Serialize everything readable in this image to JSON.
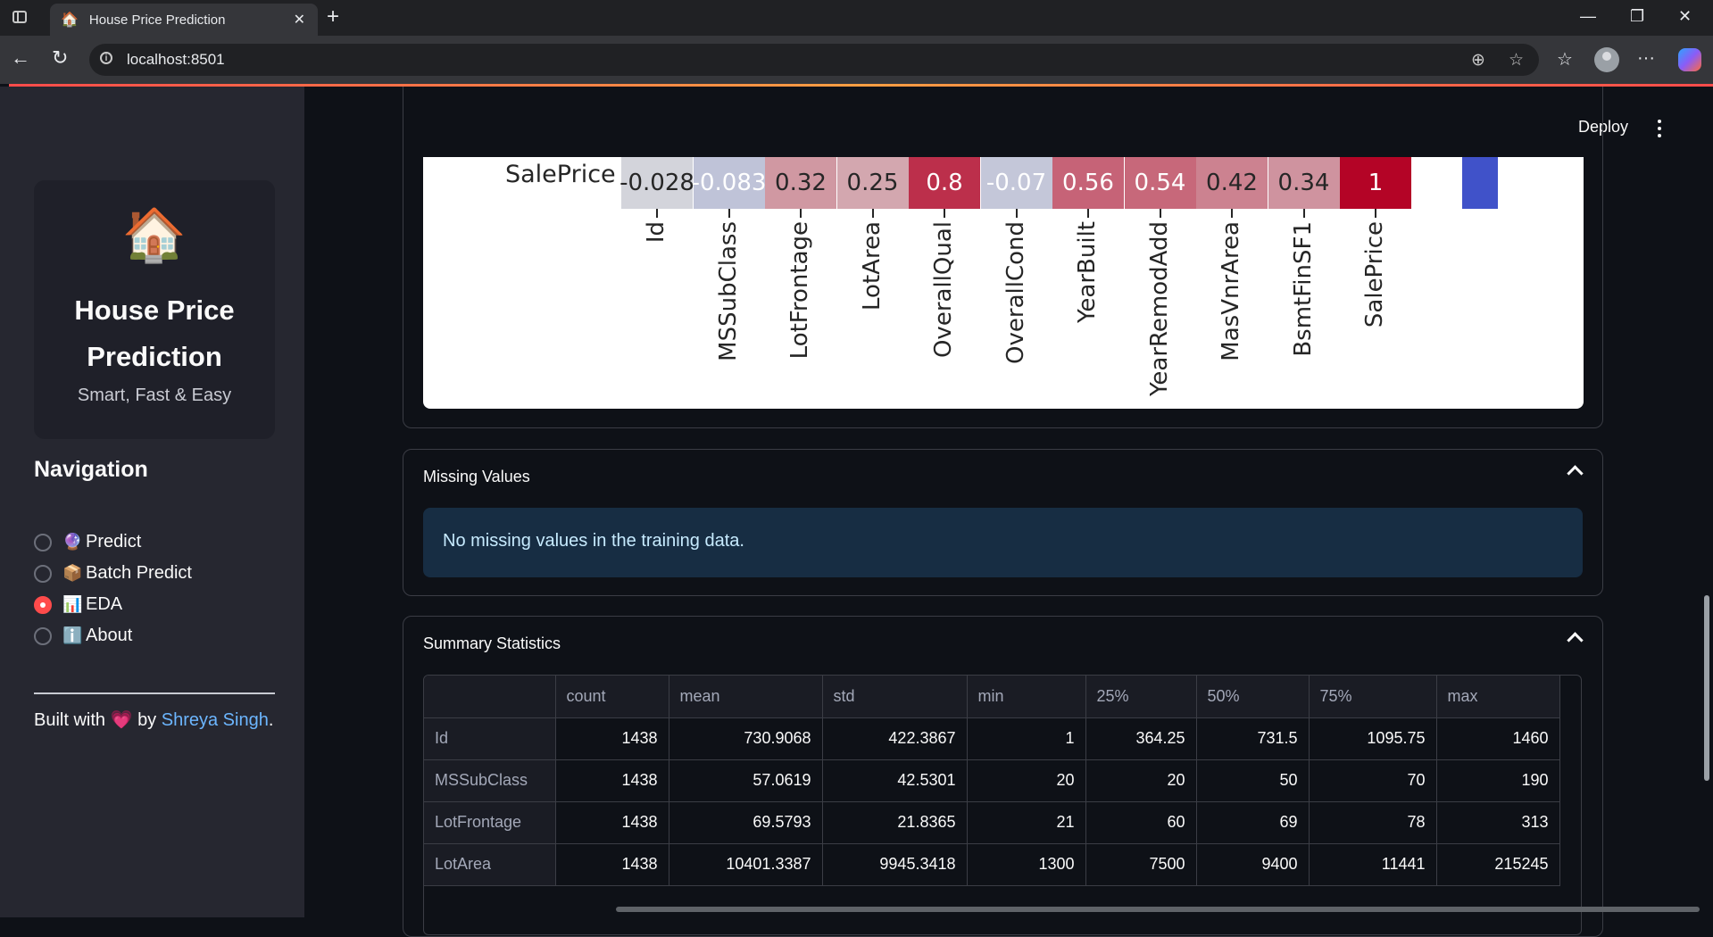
{
  "browser": {
    "tab_title": "House Price Prediction",
    "tab_favicon": "🏠",
    "url": "localhost:8501"
  },
  "sidebar": {
    "logo": "🏠",
    "title_line1": "House Price",
    "title_line2": "Prediction",
    "subtitle": "Smart, Fast & Easy",
    "nav_heading": "Navigation",
    "items": [
      {
        "emoji": "🔮",
        "label": "Predict",
        "selected": false
      },
      {
        "emoji": "📦",
        "label": "Batch Predict",
        "selected": false
      },
      {
        "emoji": "📊",
        "label": "EDA",
        "selected": true
      },
      {
        "emoji": "ℹ️",
        "label": "About",
        "selected": false
      }
    ],
    "built_prefix": "Built with",
    "built_heart": "💗",
    "built_by": "by",
    "author": "Shreya Singh",
    "built_suffix": "."
  },
  "header": {
    "deploy_label": "Deploy"
  },
  "chart_data": {
    "type": "heatmap",
    "row_label": "SalePrice",
    "columns": [
      "Id",
      "MSSubClass",
      "LotFrontage",
      "LotArea",
      "OverallQual",
      "OverallCond",
      "YearBuilt",
      "YearRemodAdd",
      "MasVnrArea",
      "BsmtFinSF1",
      "SalePrice"
    ],
    "values": [
      -0.028,
      -0.083,
      0.32,
      0.25,
      0.8,
      -0.07,
      0.56,
      0.54,
      0.42,
      0.34,
      1
    ],
    "labels": [
      "-0.028",
      "-0.083",
      "0.32",
      "0.25",
      "0.8",
      "-0.07",
      "0.56",
      "0.54",
      "0.42",
      "0.34",
      "1"
    ],
    "colormap": "coolwarm"
  },
  "missing_values": {
    "title": "Missing Values",
    "message": "No missing values in the training data."
  },
  "summary": {
    "title": "Summary Statistics",
    "columns": [
      "",
      "count",
      "mean",
      "std",
      "min",
      "25%",
      "50%",
      "75%",
      "max"
    ],
    "rows": [
      [
        "Id",
        "1438",
        "730.9068",
        "422.3867",
        "1",
        "364.25",
        "731.5",
        "1095.75",
        "1460"
      ],
      [
        "MSSubClass",
        "1438",
        "57.0619",
        "42.5301",
        "20",
        "20",
        "50",
        "70",
        "190"
      ],
      [
        "LotFrontage",
        "1438",
        "69.5793",
        "21.8365",
        "21",
        "60",
        "69",
        "78",
        "313"
      ],
      [
        "LotArea",
        "1438",
        "10401.3387",
        "9945.3418",
        "1300",
        "7500",
        "9400",
        "11441",
        "215245"
      ]
    ]
  }
}
